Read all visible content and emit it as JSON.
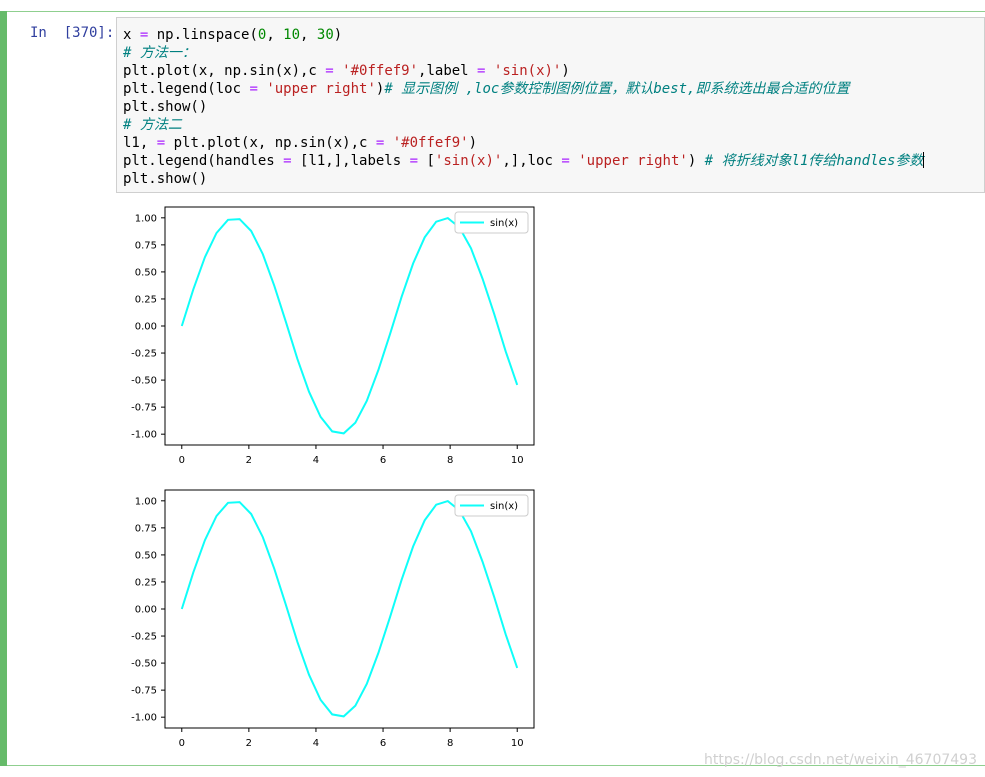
{
  "cell": {
    "prompt": "In  [370]:",
    "code_lines": [
      [
        {
          "t": "x ",
          "c": ""
        },
        {
          "t": "=",
          "c": "op"
        },
        {
          "t": " np.linspace(",
          "c": ""
        },
        {
          "t": "0",
          "c": "num"
        },
        {
          "t": ", ",
          "c": ""
        },
        {
          "t": "10",
          "c": "num"
        },
        {
          "t": ", ",
          "c": ""
        },
        {
          "t": "30",
          "c": "num"
        },
        {
          "t": ")",
          "c": ""
        }
      ],
      [
        {
          "t": "# 方法一：",
          "c": "cmt"
        }
      ],
      [
        {
          "t": "plt.plot(x, np.sin(x),c ",
          "c": ""
        },
        {
          "t": "=",
          "c": "op"
        },
        {
          "t": " ",
          "c": ""
        },
        {
          "t": "'#0ffef9'",
          "c": "str"
        },
        {
          "t": ",label ",
          "c": ""
        },
        {
          "t": "=",
          "c": "op"
        },
        {
          "t": " ",
          "c": ""
        },
        {
          "t": "'sin(x)'",
          "c": "str"
        },
        {
          "t": ")",
          "c": ""
        }
      ],
      [
        {
          "t": "plt.legend(loc ",
          "c": ""
        },
        {
          "t": "=",
          "c": "op"
        },
        {
          "t": " ",
          "c": ""
        },
        {
          "t": "'upper right'",
          "c": "str"
        },
        {
          "t": ")",
          "c": ""
        },
        {
          "t": "# 显示图例 ,loc参数控制图例位置，默认best,即系统选出最合适的位置",
          "c": "cmt"
        }
      ],
      [
        {
          "t": "plt.show()",
          "c": ""
        }
      ],
      [
        {
          "t": "# 方法二",
          "c": "cmt"
        }
      ],
      [
        {
          "t": "l1, ",
          "c": ""
        },
        {
          "t": "=",
          "c": "op"
        },
        {
          "t": " plt.plot(x, np.sin(x),c ",
          "c": ""
        },
        {
          "t": "=",
          "c": "op"
        },
        {
          "t": " ",
          "c": ""
        },
        {
          "t": "'#0ffef9'",
          "c": "str"
        },
        {
          "t": ")",
          "c": ""
        }
      ],
      [
        {
          "t": "plt.legend(handles ",
          "c": ""
        },
        {
          "t": "=",
          "c": "op"
        },
        {
          "t": " [l1,],labels ",
          "c": ""
        },
        {
          "t": "=",
          "c": "op"
        },
        {
          "t": " [",
          "c": ""
        },
        {
          "t": "'sin(x)'",
          "c": "str"
        },
        {
          "t": ",],loc ",
          "c": ""
        },
        {
          "t": "=",
          "c": "op"
        },
        {
          "t": " ",
          "c": ""
        },
        {
          "t": "'upper right'",
          "c": "str"
        },
        {
          "t": ") ",
          "c": ""
        },
        {
          "t": "# 将折线对象l1传给handles参数",
          "c": "cmt"
        }
      ],
      [
        {
          "t": "plt.show()",
          "c": ""
        }
      ]
    ],
    "colors": {
      "bar": "#66bb6a",
      "prompt": "#303f9f",
      "string": "#ba2121",
      "number": "#008800",
      "operator": "#aa22ff",
      "comment": "#008080"
    }
  },
  "chart_data": [
    {
      "type": "line",
      "x": [
        0.0,
        0.345,
        0.69,
        1.034,
        1.379,
        1.724,
        2.069,
        2.414,
        2.759,
        3.103,
        3.448,
        3.793,
        4.138,
        4.483,
        4.828,
        5.172,
        5.517,
        5.862,
        6.207,
        6.552,
        6.897,
        7.241,
        7.586,
        7.931,
        8.276,
        8.621,
        8.966,
        9.31,
        9.655,
        10.0
      ],
      "series": [
        {
          "name": "sin(x)",
          "color": "#0ffef9",
          "values": [
            0.0,
            0.338,
            0.636,
            0.86,
            0.982,
            0.988,
            0.878,
            0.665,
            0.372,
            0.038,
            -0.304,
            -0.607,
            -0.84,
            -0.974,
            -0.993,
            -0.895,
            -0.692,
            -0.406,
            -0.076,
            0.27,
            0.578,
            0.82,
            0.964,
            0.997,
            0.911,
            0.718,
            0.438,
            0.114,
            -0.235,
            -0.544
          ]
        }
      ],
      "xticks": [
        "0",
        "2",
        "4",
        "6",
        "8",
        "10"
      ],
      "yticks": [
        "1.00",
        "0.75",
        "0.50",
        "0.25",
        "0.00",
        "-0.25",
        "-0.50",
        "-0.75",
        "-1.00"
      ],
      "xlim": [
        -0.5,
        10.5
      ],
      "ylim": [
        -1.1,
        1.1
      ],
      "legend": "upper right"
    },
    {
      "type": "line",
      "x": [
        0.0,
        0.345,
        0.69,
        1.034,
        1.379,
        1.724,
        2.069,
        2.414,
        2.759,
        3.103,
        3.448,
        3.793,
        4.138,
        4.483,
        4.828,
        5.172,
        5.517,
        5.862,
        6.207,
        6.552,
        6.897,
        7.241,
        7.586,
        7.931,
        8.276,
        8.621,
        8.966,
        9.31,
        9.655,
        10.0
      ],
      "series": [
        {
          "name": "sin(x)",
          "color": "#0ffef9",
          "values": [
            0.0,
            0.338,
            0.636,
            0.86,
            0.982,
            0.988,
            0.878,
            0.665,
            0.372,
            0.038,
            -0.304,
            -0.607,
            -0.84,
            -0.974,
            -0.993,
            -0.895,
            -0.692,
            -0.406,
            -0.076,
            0.27,
            0.578,
            0.82,
            0.964,
            0.997,
            0.911,
            0.718,
            0.438,
            0.114,
            -0.235,
            -0.544
          ]
        }
      ],
      "xticks": [
        "0",
        "2",
        "4",
        "6",
        "8",
        "10"
      ],
      "yticks": [
        "1.00",
        "0.75",
        "0.50",
        "0.25",
        "0.00",
        "-0.25",
        "-0.50",
        "-0.75",
        "-1.00"
      ],
      "xlim": [
        -0.5,
        10.5
      ],
      "ylim": [
        -1.1,
        1.1
      ],
      "legend": "upper right"
    }
  ],
  "watermark": "https://blog.csdn.net/weixin_46707493"
}
